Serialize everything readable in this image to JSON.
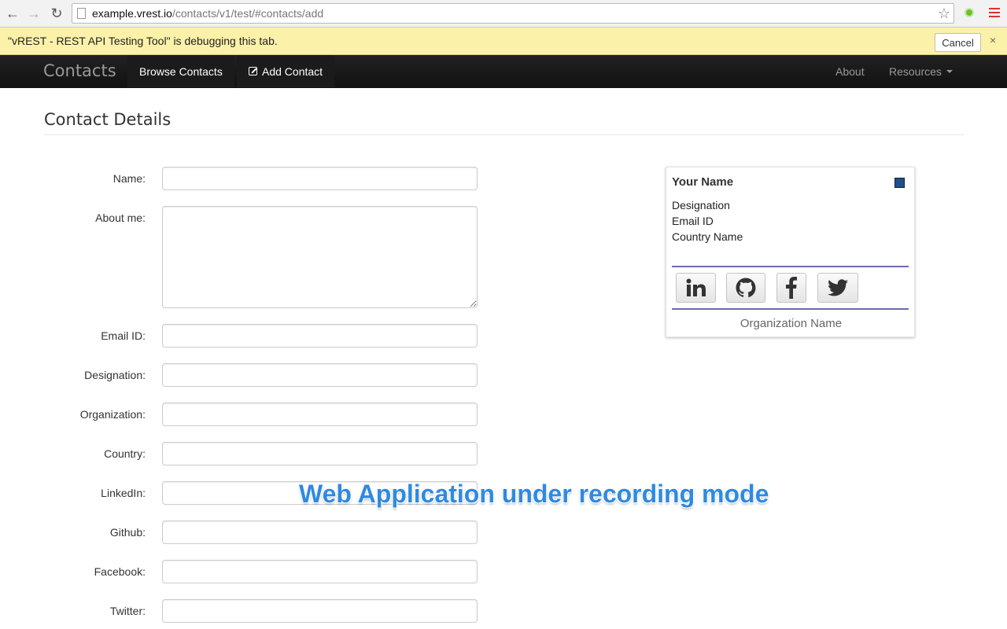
{
  "browser": {
    "url_host": "example.vrest.io",
    "url_path": "/contacts/v1/test/#contacts/add"
  },
  "debug_bar": {
    "message": "\"vREST - REST API Testing Tool\" is debugging this tab.",
    "cancel_label": "Cancel",
    "close_glyph": "×"
  },
  "navbar": {
    "brand": "Contacts",
    "browse_label": "Browse Contacts",
    "add_label": "Add Contact",
    "about_label": "About",
    "resources_label": "Resources"
  },
  "page": {
    "title": "Contact Details"
  },
  "form": {
    "name_label": "Name:",
    "about_label": "About me:",
    "email_label": "Email ID:",
    "designation_label": "Designation:",
    "organization_label": "Organization:",
    "country_label": "Country:",
    "linkedin_label": "LinkedIn:",
    "github_label": "Github:",
    "facebook_label": "Facebook:",
    "twitter_label": "Twitter:"
  },
  "card": {
    "name": "Your Name",
    "designation": "Designation",
    "email": "Email ID",
    "country": "Country Name",
    "organization": "Organization Name",
    "square_color": "#1f4e8a",
    "social_icons": [
      "linkedin-icon",
      "github-icon",
      "facebook-icon",
      "twitter-icon"
    ]
  },
  "overlay": {
    "text": "Web Application under recording mode"
  }
}
